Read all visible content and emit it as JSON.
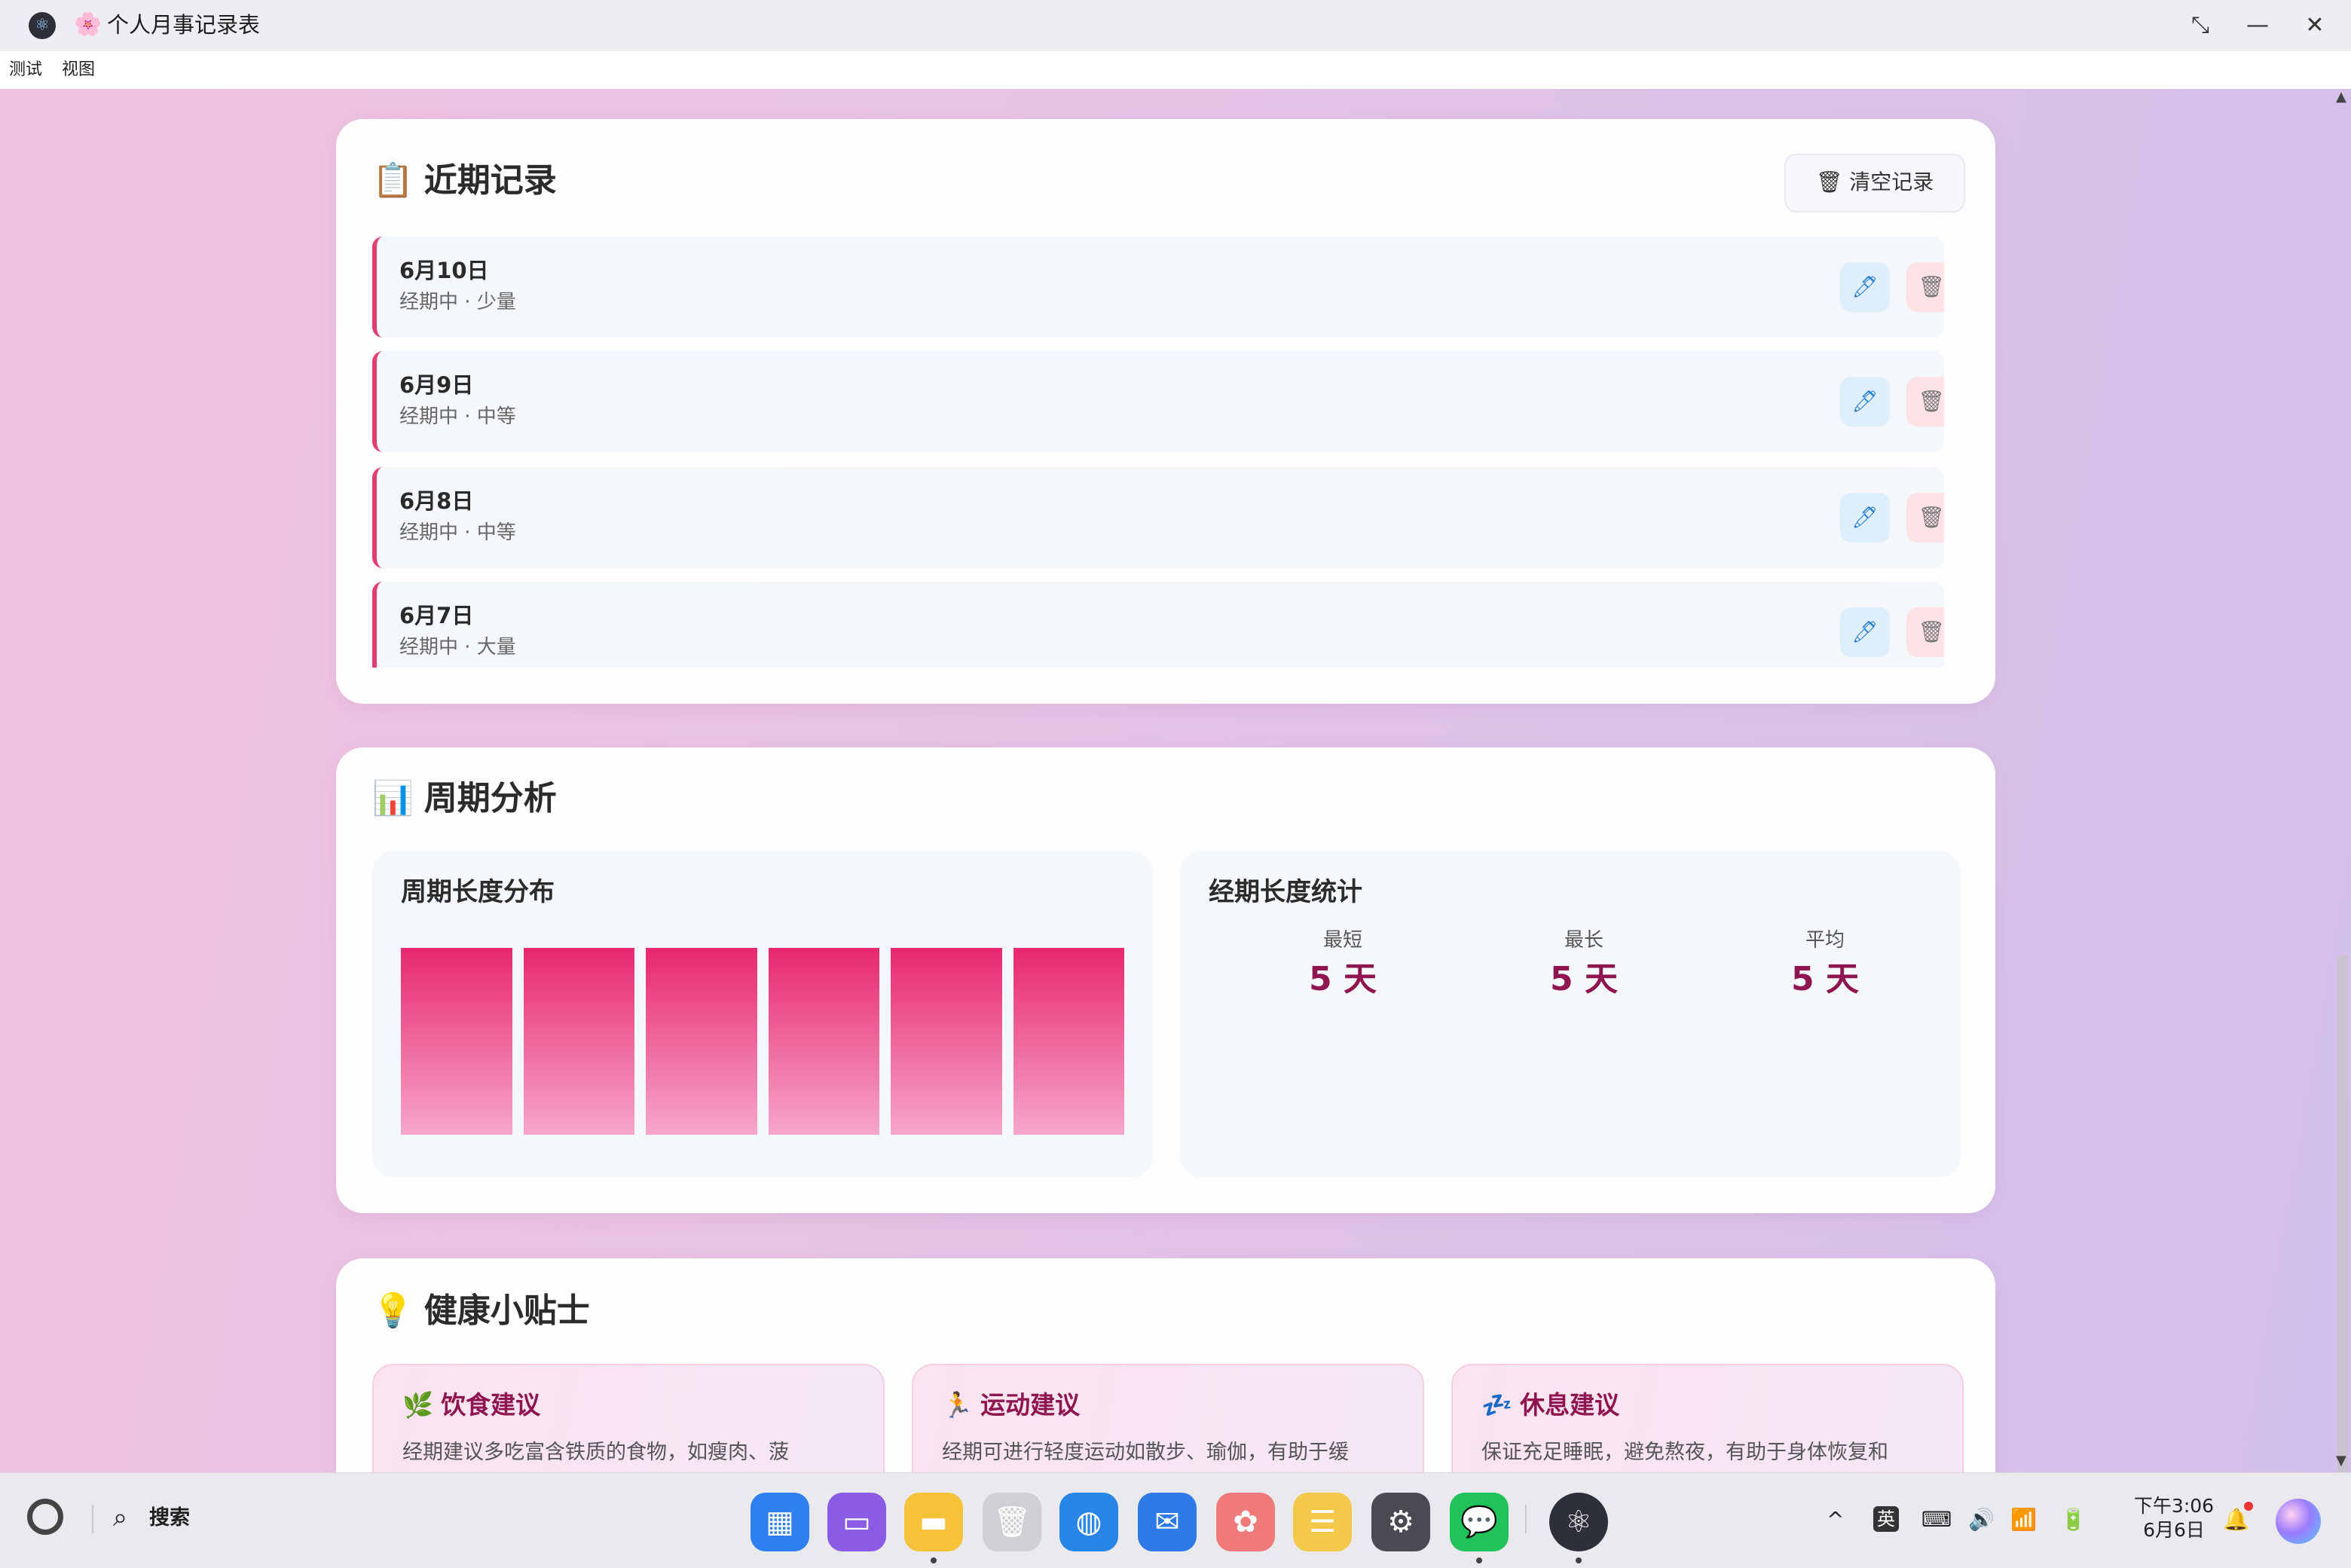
{
  "window": {
    "title": "个人月事记录表",
    "title_icon": "🌸",
    "app_icon": "electron-icon",
    "controls": {
      "restore": "⤡",
      "minimize": "—",
      "close": "✕"
    }
  },
  "menu": [
    "测试",
    "视图"
  ],
  "recent": {
    "title": "近期记录",
    "emoji": "📋",
    "clear_label": "清空记录",
    "clear_icon": "🗑",
    "records": [
      {
        "date": "6月10日",
        "desc": "经期中 · 少量"
      },
      {
        "date": "6月9日",
        "desc": "经期中 · 中等"
      },
      {
        "date": "6月8日",
        "desc": "经期中 · 中等"
      },
      {
        "date": "6月7日",
        "desc": "经期中 · 大量"
      }
    ],
    "edit_icon": "🖊",
    "delete_icon": "🗑"
  },
  "analysis": {
    "title": "周期分析",
    "emoji": "📊",
    "distribution": {
      "title": "周期长度分布"
    },
    "stats": {
      "title": "经期长度统计",
      "items": [
        {
          "label": "最短",
          "value": "5 天"
        },
        {
          "label": "最长",
          "value": "5 天"
        },
        {
          "label": "平均",
          "value": "5 天"
        }
      ]
    }
  },
  "chart_data": {
    "type": "bar",
    "title": "周期长度分布",
    "categories": [
      "",
      "",
      "",
      "",
      "",
      ""
    ],
    "values": [
      1,
      1,
      1,
      1,
      1,
      1
    ],
    "ylim": [
      0,
      1
    ],
    "grid": false,
    "color": "#e8286b"
  },
  "tips": {
    "title": "健康小贴士",
    "emoji": "💡",
    "items": [
      {
        "emoji": "🌿",
        "title": "饮食建议",
        "text": "经期建议多吃富含铁质的食物，如瘦肉、菠"
      },
      {
        "emoji": "🏃",
        "title": "运动建议",
        "text": "经期可进行轻度运动如散步、瑜伽，有助于缓"
      },
      {
        "emoji": "💤",
        "title": "休息建议",
        "text": "保证充足睡眠，避免熬夜，有助于身体恢复和"
      }
    ]
  },
  "taskbar": {
    "search_label": "搜索",
    "search_icon": "⌕",
    "apps": [
      {
        "name": "launcher",
        "glyph": "▦",
        "color": "#2f7ff0"
      },
      {
        "name": "multitask",
        "glyph": "▭",
        "color": "#8a5ce6"
      },
      {
        "name": "files",
        "glyph": "▬",
        "color": "#f5c23a"
      },
      {
        "name": "trash",
        "glyph": "🗑",
        "color": "#cfcfd4"
      },
      {
        "name": "browser",
        "glyph": "◍",
        "color": "#2a86e6"
      },
      {
        "name": "mail",
        "glyph": "✉",
        "color": "#2e7be8"
      },
      {
        "name": "photos",
        "glyph": "✿",
        "color": "#f07a7a"
      },
      {
        "name": "notes",
        "glyph": "☰",
        "color": "#f4c84a"
      },
      {
        "name": "settings",
        "glyph": "⚙",
        "color": "#4a4a52"
      },
      {
        "name": "wechat",
        "glyph": "💬",
        "color": "#20c25a"
      },
      {
        "name": "electron",
        "glyph": "⚛",
        "color": "#2d2f3a"
      }
    ],
    "tray": {
      "chevron": "^",
      "ime": "英",
      "keyboard": "⌨",
      "volume": "🔊",
      "wifi": "📶",
      "battery": "🔋",
      "bell": "🔔"
    },
    "clock_time": "下午3:06",
    "clock_date": "6月6日"
  }
}
